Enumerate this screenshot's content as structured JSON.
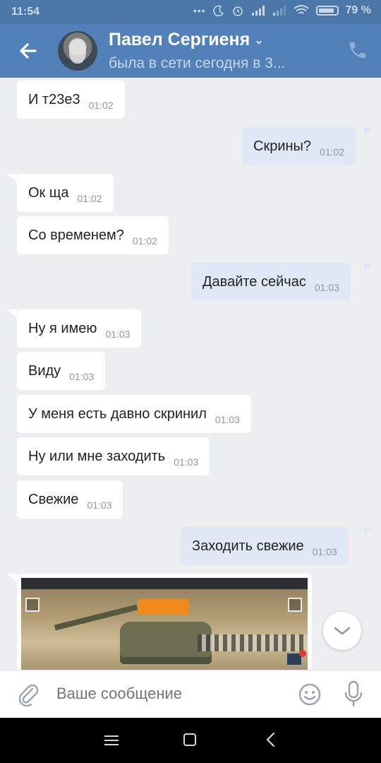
{
  "status_bar": {
    "time": "11:54",
    "battery": "79 %"
  },
  "header": {
    "name": "Павел Сергиеня",
    "status": "была в сети сегодня в 3..."
  },
  "messages": [
    {
      "dir": "in",
      "text": "И т23е3",
      "time": "01:02"
    },
    {
      "dir": "out",
      "text": "Скрины?",
      "time": "01:02"
    },
    {
      "dir": "in",
      "text": "Ок ща",
      "time": "01:02"
    },
    {
      "dir": "in",
      "text": "Со временем?",
      "time": "01:02"
    },
    {
      "dir": "out",
      "text": "Давайте сейчас",
      "time": "01:03"
    },
    {
      "dir": "in",
      "text": "Ну я имею",
      "time": "01:03"
    },
    {
      "dir": "in",
      "text": "Виду",
      "time": "01:03"
    },
    {
      "dir": "in",
      "text": "У меня есть давно скринил",
      "time": "01:03"
    },
    {
      "dir": "in",
      "text": "Ну или мне заходить",
      "time": "01:03"
    },
    {
      "dir": "in",
      "text": "Свежие",
      "time": "01:03"
    },
    {
      "dir": "out",
      "text": "Заходить свежие",
      "time": "01:03"
    }
  ],
  "composer": {
    "placeholder": "Ваше сообщение"
  },
  "colors": {
    "header": "#5181b8",
    "statusbar": "#4a76a8",
    "incoming": "#ffffff",
    "outgoing": "#dfe8f4",
    "background": "#edeef0"
  }
}
